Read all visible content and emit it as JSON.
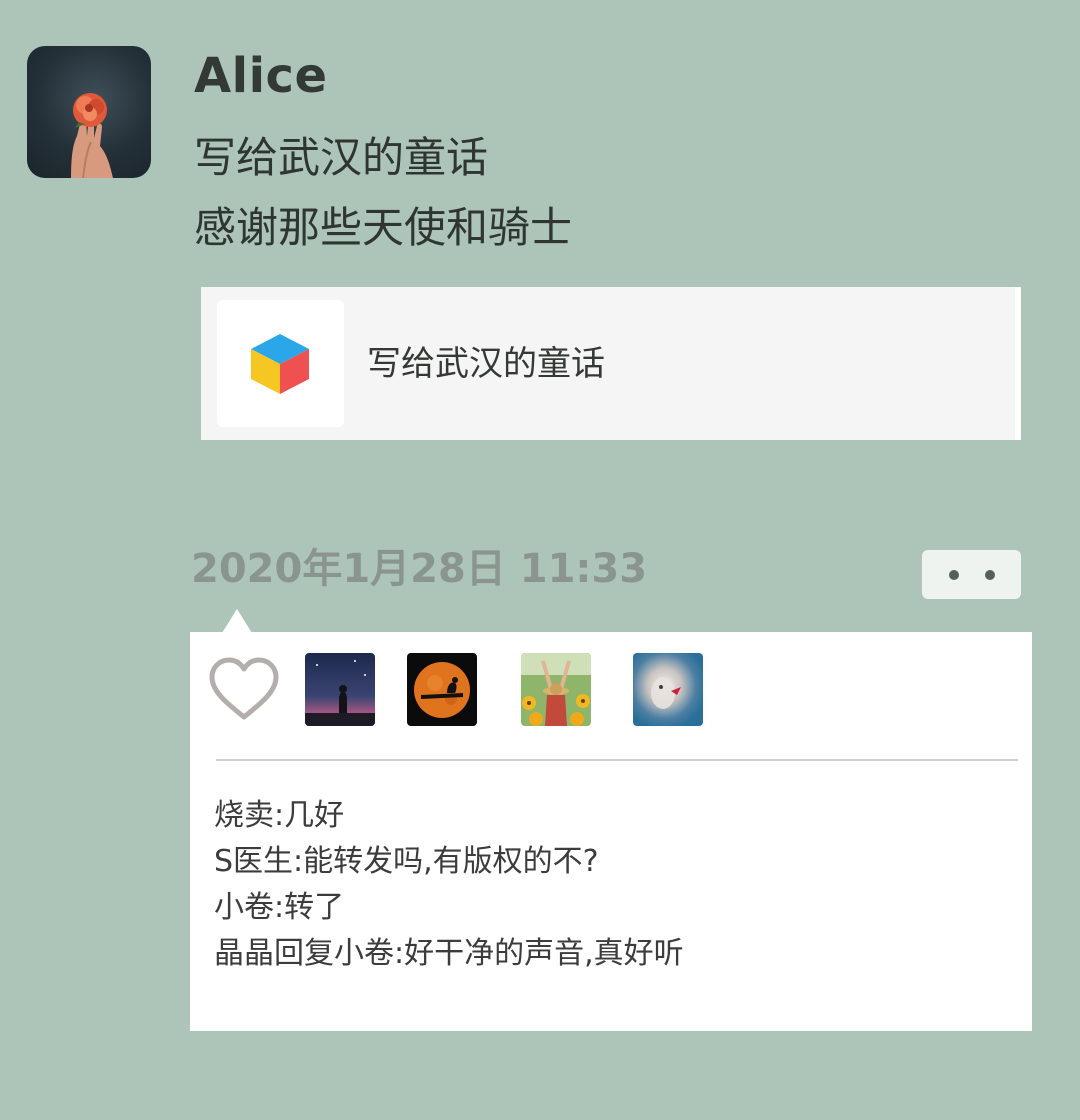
{
  "post": {
    "author": "Alice",
    "avatar_icon": "flower-in-hand-avatar",
    "text_lines": [
      "写给武汉的童话",
      "感谢那些天使和骑士"
    ],
    "link": {
      "icon": "cube-app-icon",
      "title": "写给武汉的童话"
    },
    "timestamp": "2020年1月28日 11:33",
    "more_icon": "more-dots-icon"
  },
  "interactions": {
    "like_icon": "heart-outline-icon",
    "likers": [
      {
        "avatar": "night-sky-silhouette-avatar"
      },
      {
        "avatar": "moon-silhouette-avatar"
      },
      {
        "avatar": "sunflower-field-avatar"
      },
      {
        "avatar": "blurred-portrait-avatar"
      }
    ],
    "comments": [
      {
        "text": "烧卖:几好"
      },
      {
        "text": "S医生:能转发吗,有版权的不?"
      },
      {
        "text": "小卷:转了"
      },
      {
        "text": "晶晶回复小卷:好干净的声音,真好听"
      }
    ]
  },
  "colors": {
    "background": "#adc5b9",
    "card": "#f5f5f5",
    "panel": "#ffffff",
    "timestamp": "#8b958f",
    "cube_top": "#2aa7e8",
    "cube_left": "#f6c722",
    "cube_right": "#ef5150"
  }
}
